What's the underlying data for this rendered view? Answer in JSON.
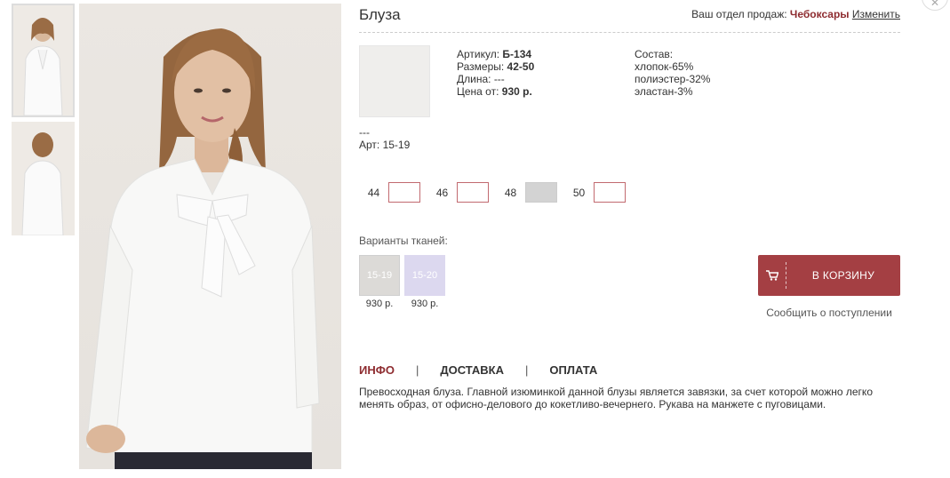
{
  "product": {
    "title": "Блуза",
    "sku_label": "Артикул:",
    "sku_value": "Б-134",
    "sizes_label": "Размеры:",
    "sizes_value": "42-50",
    "length_label": "Длина:",
    "length_value": "---",
    "price_label": "Цена от:",
    "price_value": "930 р.",
    "dash": "---",
    "art": "Арт: 15-19"
  },
  "sales": {
    "label": "Ваш отдел продаж:",
    "city": "Чебоксары",
    "change": "Изменить"
  },
  "composition": {
    "title": "Состав:",
    "items": [
      "хлопок-65%",
      "полиэстер-32%",
      "эластан-3%"
    ]
  },
  "sizes": [
    {
      "label": "44",
      "available": true
    },
    {
      "label": "46",
      "available": true
    },
    {
      "label": "48",
      "available": false
    },
    {
      "label": "50",
      "available": true
    }
  ],
  "fabrics": {
    "title": "Варианты тканей:",
    "items": [
      {
        "code": "15-19",
        "price": "930 р.",
        "color": "#dcdad7"
      },
      {
        "code": "15-20",
        "price": "930 р.",
        "color": "#dcd8ef"
      }
    ]
  },
  "cart": {
    "button_label": "В КОРЗИНУ",
    "notify_label": "Сообщить о поступлении",
    "color": "#a43f43"
  },
  "tabs": {
    "items": [
      "ИНФО",
      "ДОСТАВКА",
      "ОПЛАТА"
    ],
    "active": "ИНФО",
    "separator": "|"
  },
  "description": "Превосходная блуза. Главной изюминкой данной блузы является завязки, за счет которой можно легко менять образ, от офисно-делового до кокетливо-вечернего. Рукава на манжете с пуговицами.",
  "icons": {
    "cart": "cart-icon",
    "close": "close-icon"
  }
}
